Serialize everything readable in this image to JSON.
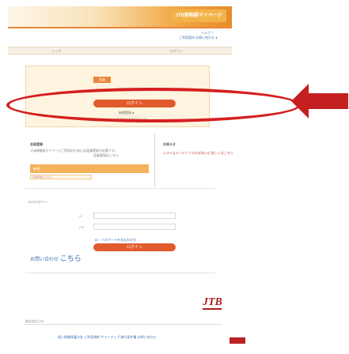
{
  "header": {
    "brand": "JTB旅物語マイページ",
    "links": [
      "ヘルプ ？",
      "ご利用案内 お問い合わせ ●"
    ]
  },
  "nav": {
    "items": [
      "トップ",
      "ログイン"
    ]
  },
  "login_panel": {
    "tab_label": "会員",
    "primary_button": "ログイン",
    "sub_text": "新規登録 ●",
    "sub_text2": "パスワードを忘れた方"
  },
  "info": {
    "left_title": "会員登録",
    "left_text": "JTB旅物語マイページご利用のためには会員登録が必要です。",
    "left_sub": "会員登録はこちら",
    "right_title": "お知らせ",
    "right_text": "システムメンテナンスのお知らせ 詳しくはこちら",
    "orange_bar_label": "新規",
    "orange_bar_note": "会員登録はこちら"
  },
  "form": {
    "label": "IDでログイン",
    "field1_caption": "ID",
    "field2_caption": "PW",
    "link_text": "ID・パスワードをお忘れの方",
    "login_button": "ログイン",
    "help_prefix": "お問い合わせ",
    "help_big": "こちら"
  },
  "footer": {
    "logo_text": "JTB",
    "company": "株式会社JTB",
    "links": "個人情報保護方針  ご利用規約  サイトマップ  旅行条件書  お問い合わせ"
  }
}
